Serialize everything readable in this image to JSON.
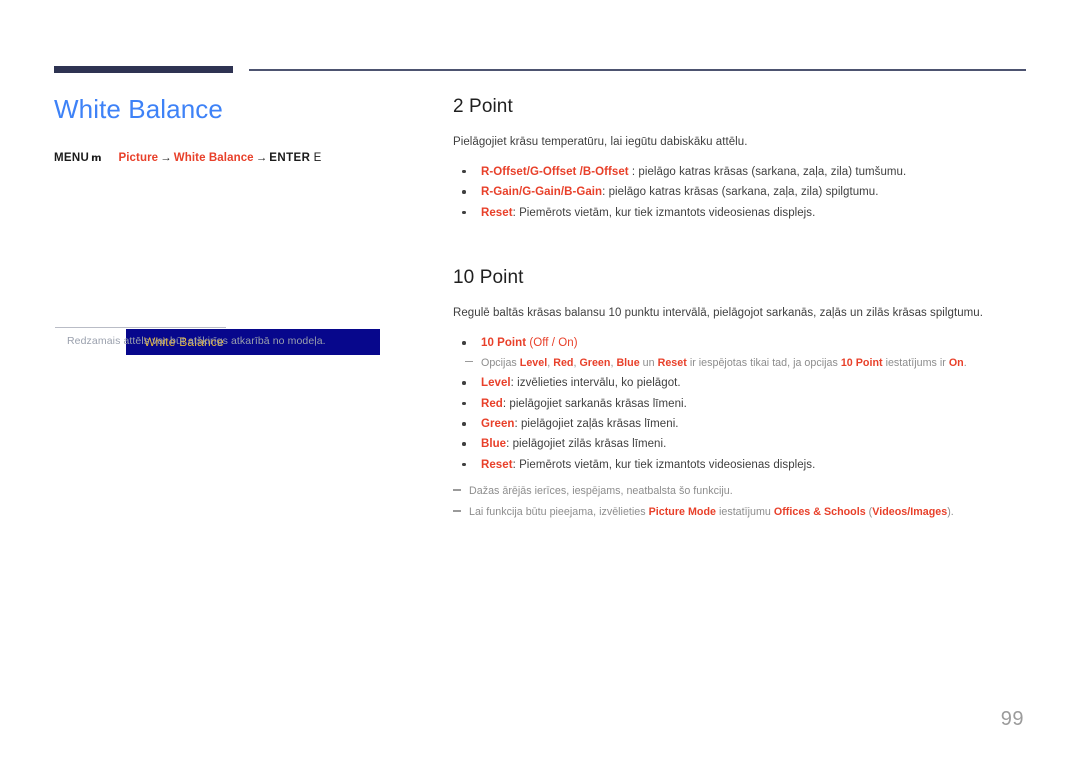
{
  "header": {
    "rule_color_thick": "#2e3352",
    "rule_color_thin": "#4d5370"
  },
  "left": {
    "page_title": "White Balance",
    "menu": {
      "menu_label": "MENU",
      "menu_icon_glyph": "m",
      "arrow": "→",
      "path_1": "Picture",
      "path_2": "White Balance",
      "enter_label": "ENTER",
      "enter_key": "E"
    },
    "osd": {
      "row_label": "White Balance",
      "bg_color": "#07078c",
      "text_color": "#e8b93a"
    },
    "caption": "Redzamais attēls var būt atšķirīgs atkarībā no modeļa."
  },
  "right": {
    "section_2point": {
      "heading": "2 Point",
      "lead": "Pielāgojiet krāsu temperatūru, lai iegūtu dabiskāku attēlu.",
      "bullets": [
        {
          "term": "R-Offset/G-Offset /B-Offset",
          "desc": " : pielāgo katras krāsas (sarkana, zaļa, zila) tumšumu."
        },
        {
          "term": "R-Gain/G-Gain/B-Gain",
          "desc": ": pielāgo katras krāsas (sarkana, zaļa, zila) spilgtumu."
        },
        {
          "term": "Reset",
          "desc": ": Piemērots vietām, kur tiek izmantots videosienas displejs."
        }
      ]
    },
    "section_10point": {
      "heading": "10 Point",
      "lead": "Regulē baltās krāsas balansu 10 punktu intervālā, pielāgojot sarkanās, zaļās un zilās krāsas spilgtumu.",
      "option_bullet": {
        "term": "10 Point",
        "open_paren": " (",
        "opt_off": "Off",
        "sep": " / ",
        "opt_on": "On",
        "close_paren": ")"
      },
      "subnote": {
        "p1": "Opcijas ",
        "t1": "Level",
        "s1": ", ",
        "t2": "Red",
        "s2": ", ",
        "t3": "Green",
        "s3": ", ",
        "t4": "Blue",
        "p2": " un ",
        "t5": "Reset",
        "p3": " ir iespējotas tikai tad, ja opcijas ",
        "t6": "10 Point",
        "p4": " iestatījums ir ",
        "t7": "On",
        "p5": "."
      },
      "bullets": [
        {
          "term": "Level",
          "desc": ": izvēlieties intervālu, ko pielāgot."
        },
        {
          "term": "Red",
          "desc": ": pielāgojiet sarkanās krāsas līmeni."
        },
        {
          "term": "Green",
          "desc": ": pielāgojiet zaļās krāsas līmeni."
        },
        {
          "term": "Blue",
          "desc": ": pielāgojiet zilās krāsas līmeni."
        },
        {
          "term": "Reset",
          "desc": ": Piemērots vietām, kur tiek izmantots videosienas displejs."
        }
      ],
      "notes": {
        "note1": "Dažas ārējās ierīces, iespējams, neatbalsta šo funkciju.",
        "note2_p1": "Lai funkcija būtu pieejama, izvēlieties ",
        "note2_t1": "Picture Mode",
        "note2_p2": " iestatījumu ",
        "note2_t2": "Offices & Schools",
        "note2_p3": " (",
        "note2_t3": "Videos/Images",
        "note2_p4": ")."
      }
    }
  },
  "footer": {
    "page_number": "99"
  },
  "colors": {
    "accent_red": "#e8402a",
    "title_blue": "#3e82f7",
    "osd_navy": "#07078c",
    "osd_gold": "#e8b93a",
    "rule_navy": "#2e3352"
  }
}
